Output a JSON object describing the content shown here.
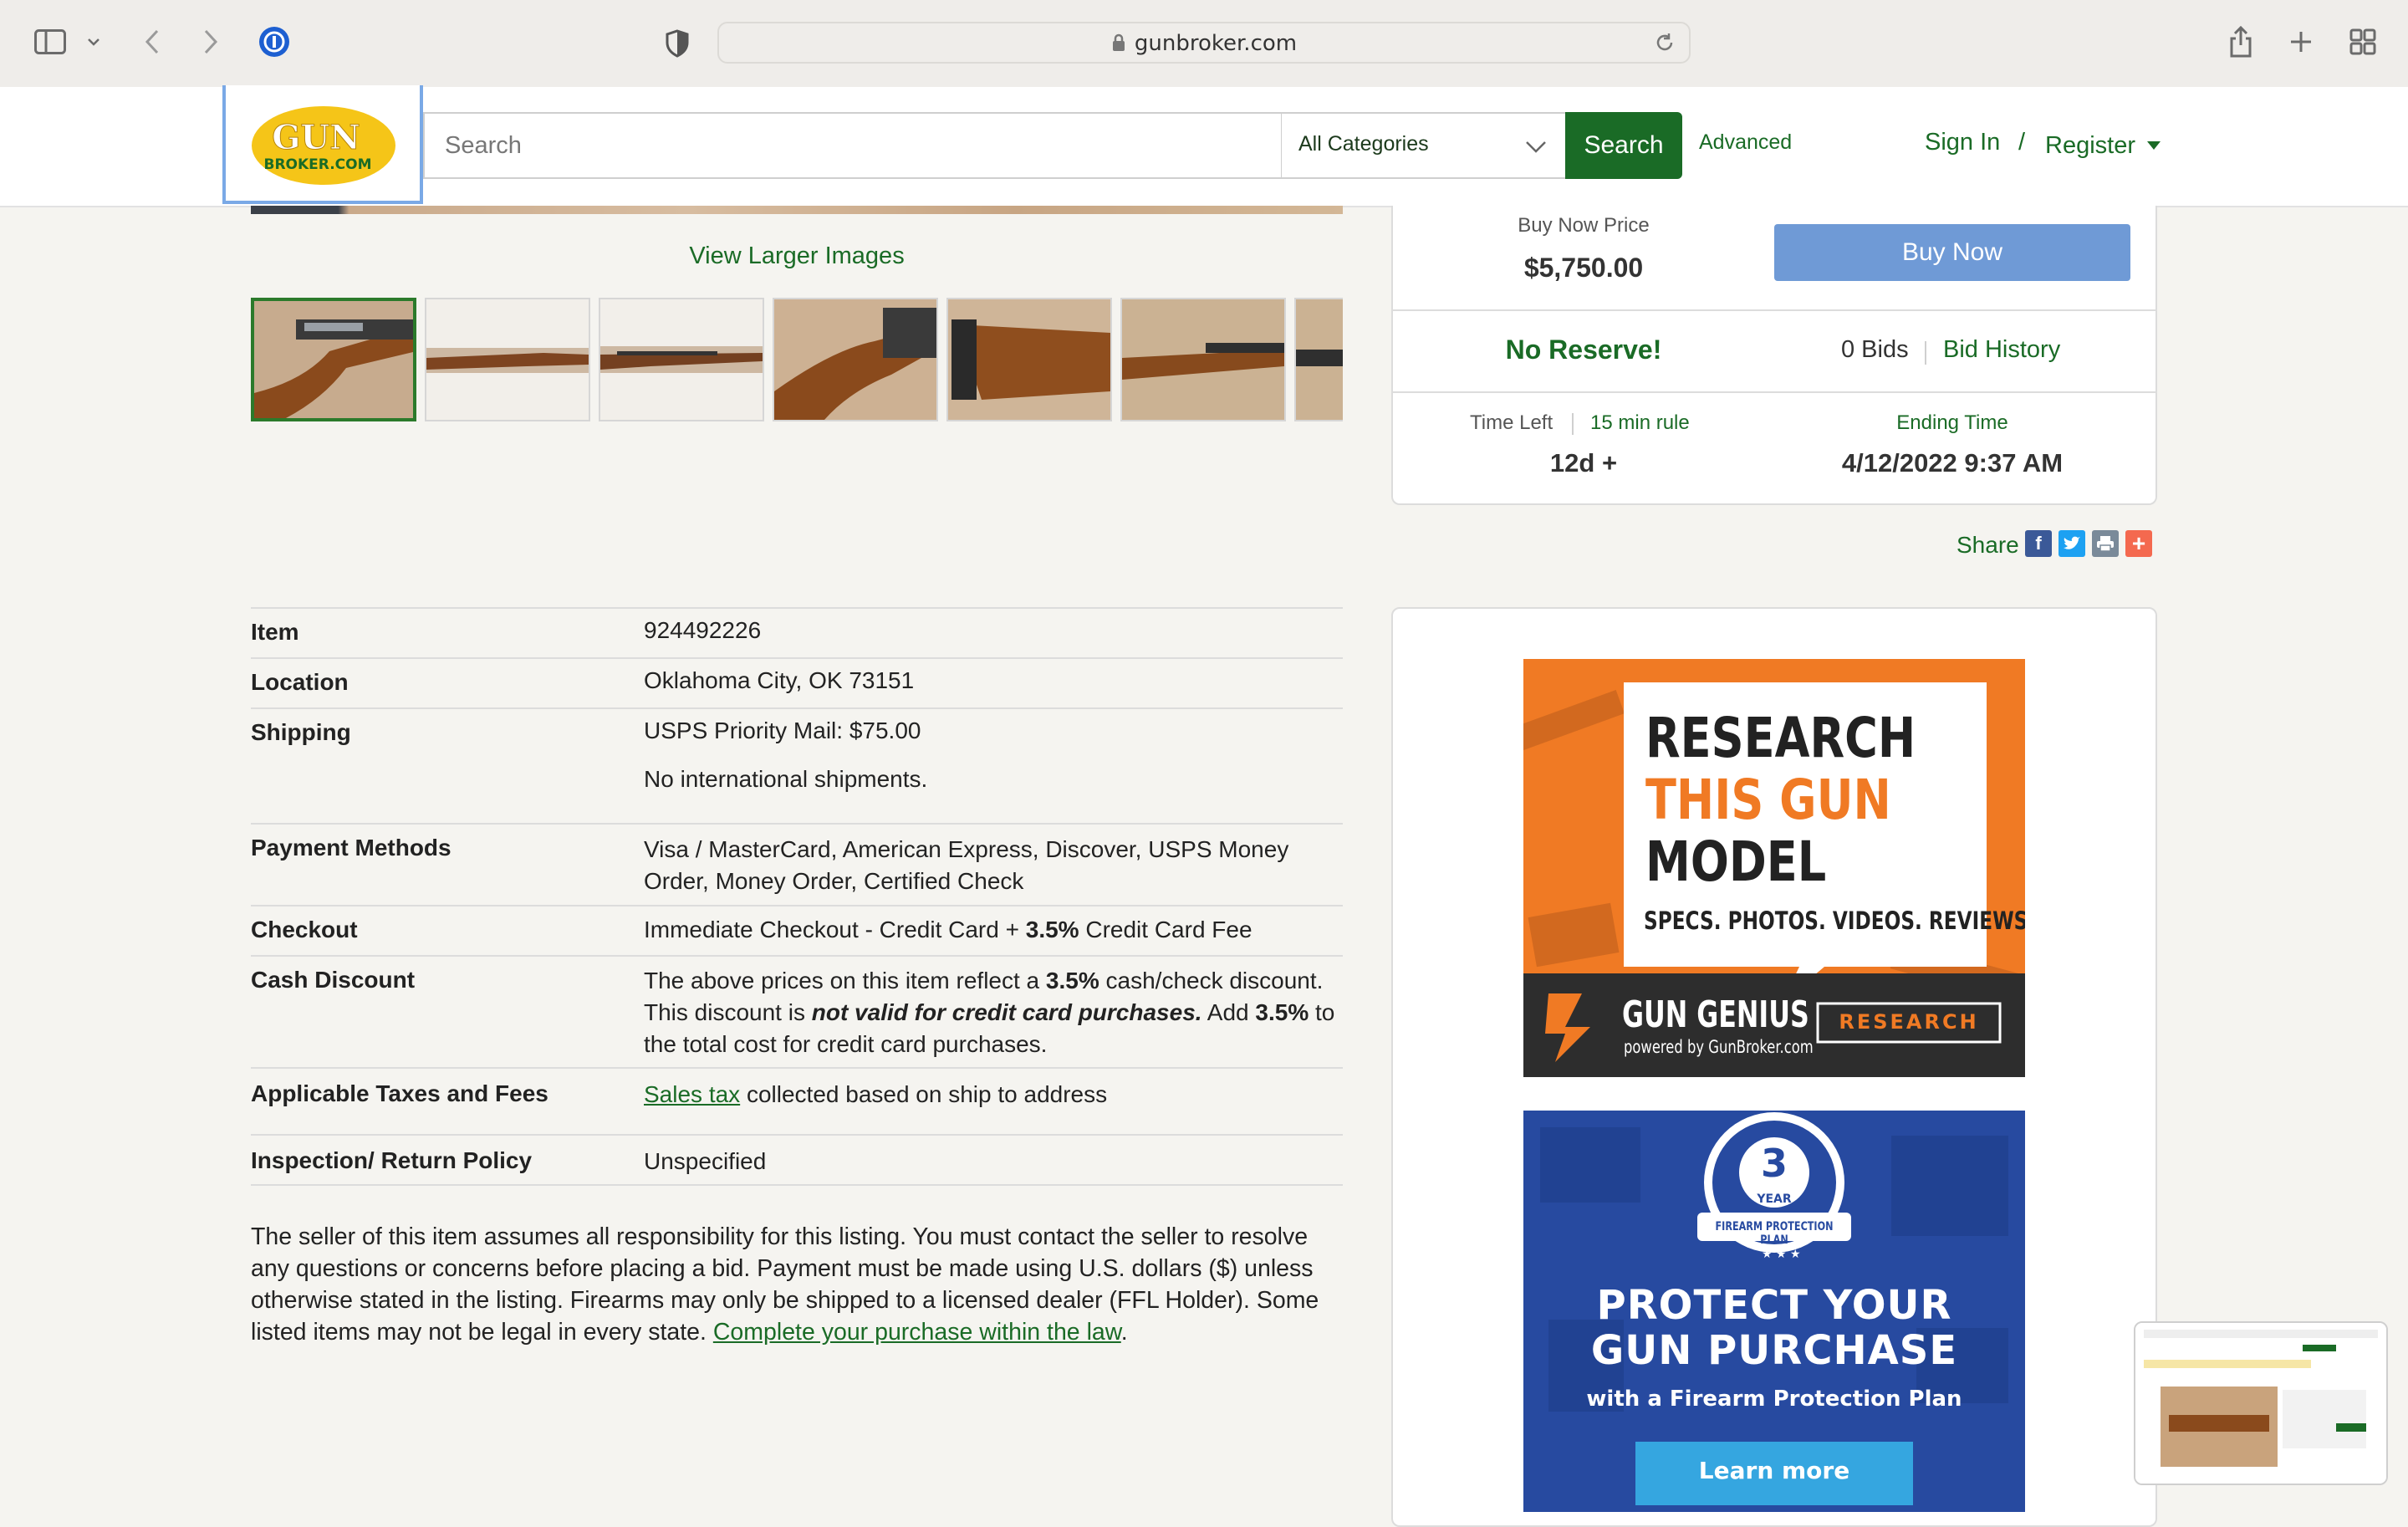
{
  "browser": {
    "url_host": "gunbroker.com"
  },
  "header": {
    "logo_top": "GUN",
    "logo_bottom": "BROKER.COM",
    "search_placeholder": "Search",
    "category_selected": "All Categories",
    "search_button": "Search",
    "advanced_link": "Advanced",
    "sign_in": "Sign In",
    "separator": "/",
    "register": "Register"
  },
  "gallery": {
    "view_larger": "View Larger Images"
  },
  "bid_panel": {
    "buy_now_price_label": "Buy Now Price",
    "buy_now_price": "$5,750.00",
    "buy_now_button": "Buy Now",
    "reserve": "No Reserve!",
    "bids": "0 Bids",
    "bid_history": "Bid History",
    "time_left_label": "Time Left",
    "rule_link": "15 min rule",
    "time_left": "12d +",
    "ending_time_label": "Ending Time",
    "ending_time": "4/12/2022 9:37 AM",
    "share_label": "Share"
  },
  "details": {
    "item_label": "Item",
    "item_value": "924492226",
    "location_label": "Location",
    "location_value": "Oklahoma City, OK 73151",
    "shipping_label": "Shipping",
    "shipping_value": "USPS Priority Mail: $75.00",
    "shipping_note": "No international shipments.",
    "payment_label": "Payment Methods",
    "payment_value": "Visa / MasterCard, American Express, Discover, USPS Money Order, Money Order, Certified Check",
    "checkout_label": "Checkout",
    "checkout_pre": "Immediate Checkout - Credit Card + ",
    "checkout_bold": "3.5%",
    "checkout_post": " Credit Card Fee",
    "cash_label": "Cash Discount",
    "cash_1": "The above prices on this item reflect a ",
    "cash_2": "3.5%",
    "cash_3": " cash/check discount. This discount is ",
    "cash_4": "not valid for credit card purchases.",
    "cash_5": " Add ",
    "cash_6": "3.5%",
    "cash_7": " to the total cost for credit card purchases.",
    "taxes_label": "Applicable Taxes and Fees",
    "taxes_link": "Sales tax",
    "taxes_rest": " collected based on ship to address",
    "return_label": "Inspection/ Return Policy",
    "return_value": "Unspecified"
  },
  "disclaimer": {
    "text": "The seller of this item assumes all responsibility for this listing. You must contact the seller to resolve any questions or concerns before placing a bid. Payment must be made using U.S. dollars ($) unless otherwise stated in the listing. Firearms may only be shipped to a licensed dealer (FFL Holder). Some listed items may not be legal in every state. ",
    "link": "Complete your purchase within the law",
    "end": "."
  },
  "ad_research": {
    "line1": "RESEARCH",
    "line2": "THIS GUN",
    "line3": "MODEL",
    "tagline": "SPECS. PHOTOS. VIDEOS. REVIEWS.",
    "brand": "GUN GENIUS",
    "brand_sub": "powered by GunBroker.com",
    "button": "RESEARCH"
  },
  "ad_protect": {
    "badge_number": "3",
    "badge_year": "YEAR",
    "badge_plan": "FIREARM PROTECTION PLAN",
    "line1": "PROTECT YOUR",
    "line2": "GUN PURCHASE",
    "sub": "with a Firearm Protection Plan",
    "button": "Learn more"
  },
  "colors": {
    "brand_green": "#1a6b26",
    "buy_now_blue": "#6f9ad6",
    "logo_yellow": "#f5c518",
    "ad_orange": "#f07a24",
    "ad_blue": "#274aa0"
  }
}
